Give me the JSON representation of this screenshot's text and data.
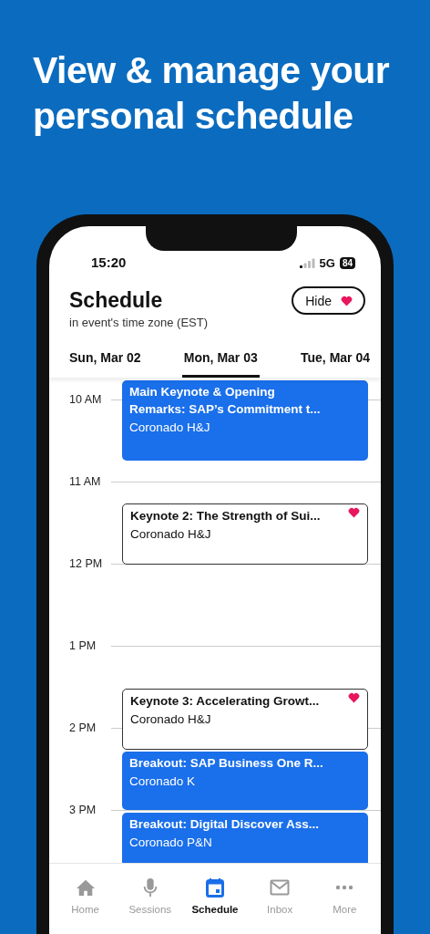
{
  "headline": "View & manage your personal schedule",
  "status_bar": {
    "time": "15:20",
    "network": "5G",
    "battery": "84"
  },
  "header": {
    "title": "Schedule",
    "subtitle": "in event's time zone (EST)",
    "hide_button": "Hide"
  },
  "day_tabs": [
    {
      "label": "Sun, Mar 02",
      "selected": false
    },
    {
      "label": "Mon, Mar 03",
      "selected": true
    },
    {
      "label": "Tue, Mar 04",
      "selected": false
    }
  ],
  "hours": [
    "10 AM",
    "11 AM",
    "12 PM",
    "1 PM",
    "2 PM",
    "3 PM"
  ],
  "events": [
    {
      "kind": "highlight",
      "title": "Main Keynote & Opening Remarks: SAP’s Commitment t...",
      "room": "Coronado H&J",
      "favorite": false
    },
    {
      "kind": "outline",
      "title": "Keynote 2: The Strength of Sui...",
      "room": "Coronado H&J",
      "favorite": true
    },
    {
      "kind": "outline",
      "title": "Keynote 3: Accelerating Growt...",
      "room": "Coronado H&J",
      "favorite": true
    },
    {
      "kind": "highlight",
      "title": "Breakout: SAP Business One R...",
      "room": "Coronado K",
      "favorite": false
    },
    {
      "kind": "highlight",
      "title": "Breakout: Digital Discover Ass...",
      "room": "Coronado P&N",
      "favorite": false
    }
  ],
  "nav": [
    {
      "kind": "home",
      "label": "Home",
      "selected": false
    },
    {
      "kind": "mic",
      "label": "Sessions",
      "selected": false
    },
    {
      "kind": "calendar",
      "label": "Schedule",
      "selected": true
    },
    {
      "kind": "mail",
      "label": "Inbox",
      "selected": false
    },
    {
      "kind": "more",
      "label": "More",
      "selected": false
    }
  ]
}
